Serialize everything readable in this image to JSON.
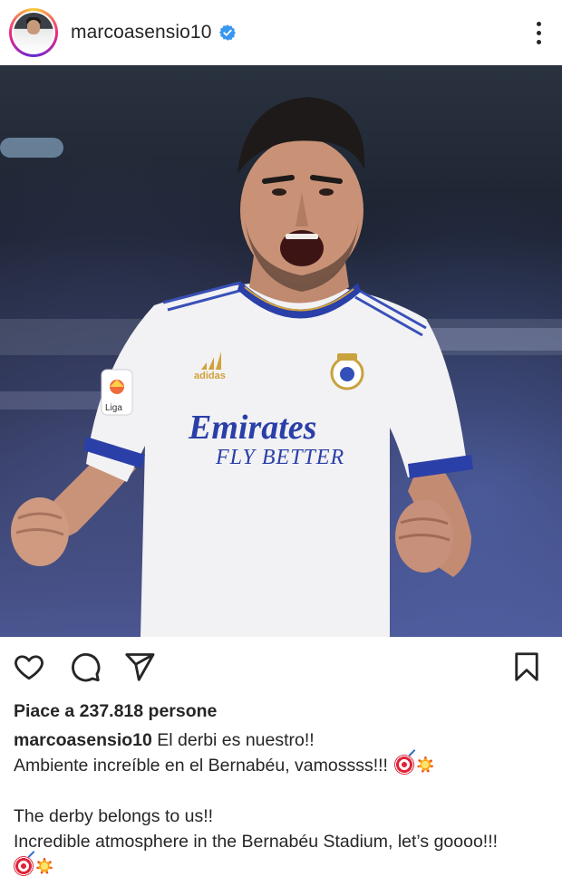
{
  "post": {
    "username": "marcoasensio10",
    "verified": true,
    "likes_text": "Piace a 237.818 persone",
    "caption": {
      "user": "marcoasensio10",
      "line1": "El derbi es nuestro!!",
      "line2": "Ambiente increíble en el Bernabéu, vamossss!!!",
      "line3": "The derby belongs to us!!",
      "line4": "Incredible atmosphere in the Bernabéu Stadium, let’s goooo!!!"
    },
    "photo": {
      "shirt_sponsor_line1": "Emirates",
      "shirt_sponsor_line2": "FLY BETTER",
      "kit_brand": "adidas",
      "sleeve_patch": "Liga"
    }
  },
  "icons": {
    "more": "more-vertical-icon",
    "like": "heart-icon",
    "comment": "comment-icon",
    "share": "paper-plane-icon",
    "save": "bookmark-icon",
    "verified": "verified-badge-icon",
    "emoji_1": "direct-hit-emoji",
    "emoji_2": "collision-emoji"
  },
  "colors": {
    "text": "#262626",
    "verified_blue": "#3897f0",
    "jersey_white": "#f2f2f4",
    "jersey_trim": "#2b3fa8"
  }
}
